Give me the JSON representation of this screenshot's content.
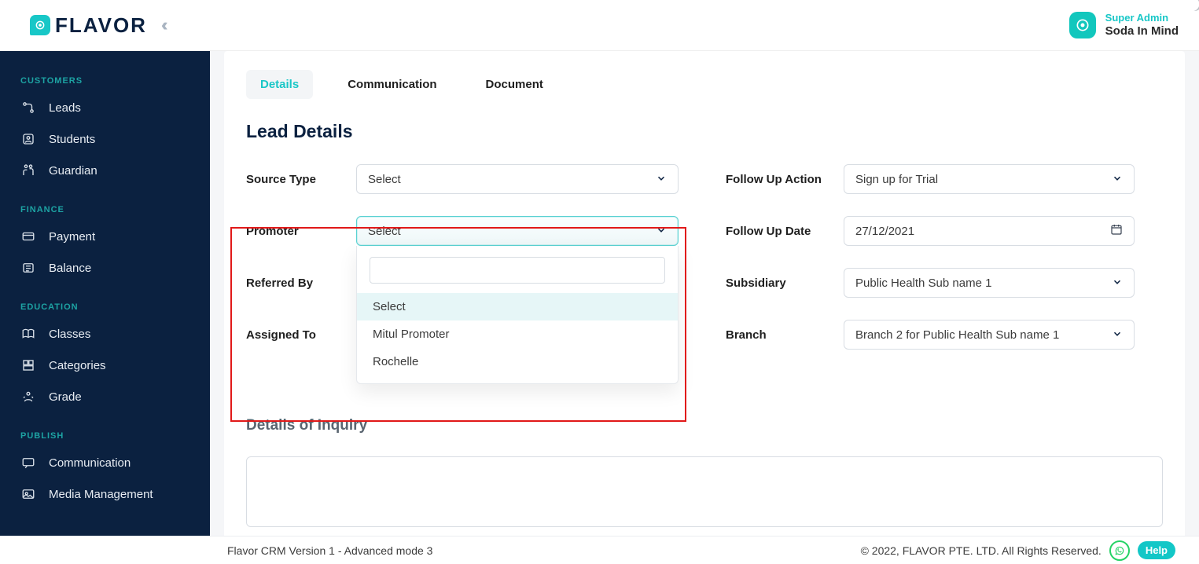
{
  "brand": {
    "name": "FLAVOR"
  },
  "user": {
    "role": "Super Admin",
    "name": "Soda In Mind"
  },
  "sidebar": {
    "sections": [
      {
        "title": "CUSTOMERS",
        "items": [
          {
            "icon": "leads",
            "label": "Leads"
          },
          {
            "icon": "students",
            "label": "Students"
          },
          {
            "icon": "guardian",
            "label": "Guardian"
          }
        ]
      },
      {
        "title": "FINANCE",
        "items": [
          {
            "icon": "payment",
            "label": "Payment"
          },
          {
            "icon": "balance",
            "label": "Balance"
          }
        ]
      },
      {
        "title": "EDUCATION",
        "items": [
          {
            "icon": "classes",
            "label": "Classes"
          },
          {
            "icon": "categories",
            "label": "Categories"
          },
          {
            "icon": "grade",
            "label": "Grade"
          }
        ]
      },
      {
        "title": "PUBLISH",
        "items": [
          {
            "icon": "communication",
            "label": "Communication"
          },
          {
            "icon": "media",
            "label": "Media Management"
          }
        ]
      }
    ]
  },
  "tabs": [
    {
      "label": "Details",
      "active": true
    },
    {
      "label": "Communication",
      "active": false
    },
    {
      "label": "Document",
      "active": false
    }
  ],
  "section": {
    "leadDetails": "Lead Details",
    "inquiry": "Details of Inquiry"
  },
  "form": {
    "sourceType": {
      "label": "Source Type",
      "value": "Select"
    },
    "followUpAction": {
      "label": "Follow Up Action",
      "value": "Sign up for Trial"
    },
    "promoter": {
      "label": "Promoter",
      "value": "Select",
      "options": [
        "Select",
        "Mitul Promoter",
        "Rochelle"
      ]
    },
    "followUpDate": {
      "label": "Follow Up Date",
      "value": "27/12/2021"
    },
    "referredBy": {
      "label": "Referred By"
    },
    "subsidiary": {
      "label": "Subsidiary",
      "value": "Public Health Sub name 1"
    },
    "assignedTo": {
      "label": "Assigned To"
    },
    "branch": {
      "label": "Branch",
      "value": "Branch 2 for Public Health Sub name 1"
    }
  },
  "footer": {
    "version": "Flavor CRM Version 1 - Advanced mode 3",
    "copyright": "© 2022, FLAVOR PTE. LTD. All Rights Reserved.",
    "help": "Help"
  }
}
